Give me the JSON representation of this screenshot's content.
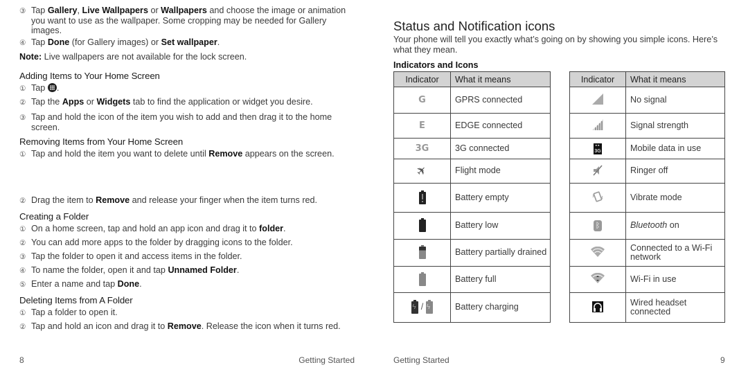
{
  "left_page": {
    "wallpaper_steps": [
      {
        "num": "③",
        "parts": [
          [
            "Tap ",
            false
          ],
          [
            "Gallery",
            true
          ],
          [
            ", ",
            false
          ],
          [
            "Live Wallpapers",
            true
          ],
          [
            " or ",
            false
          ],
          [
            "Wallpapers",
            true
          ],
          [
            " and choose the image or animation you want to use as the wallpaper. Some cropping may be needed for Gallery images.",
            false
          ]
        ]
      },
      {
        "num": "④",
        "parts": [
          [
            "Tap ",
            false
          ],
          [
            "Done",
            true
          ],
          [
            " (for Gallery images) or ",
            false
          ],
          [
            "Set wallpaper",
            true
          ],
          [
            ".",
            false
          ]
        ]
      }
    ],
    "note_label": "Note:",
    "note_text": " Live wallpapers are not available for the lock screen.",
    "adding": {
      "heading": "Adding Items to Your Home Screen",
      "step1_num": "①",
      "step1_text": "Tap ",
      "step1_icon": "apps-launcher-icon",
      "step1_end": ".",
      "steps": [
        {
          "num": "②",
          "parts": [
            [
              "Tap the ",
              false
            ],
            [
              "Apps",
              true
            ],
            [
              " or ",
              false
            ],
            [
              "Widgets",
              true
            ],
            [
              " tab to find the application or widget you desire.",
              false
            ]
          ]
        },
        {
          "num": "③",
          "parts": [
            [
              "Tap and hold the icon of the item you wish to add and then drag it to the home screen.",
              false
            ]
          ]
        }
      ]
    },
    "removing": {
      "heading": "Removing Items from Your Home Screen",
      "steps": [
        {
          "num": "①",
          "parts": [
            [
              "Tap and hold the item you want to delete until ",
              false
            ],
            [
              "Remove",
              true
            ],
            [
              " appears on the screen.",
              false
            ]
          ]
        },
        {
          "num": "②",
          "parts": [
            [
              "Drag the item to ",
              false
            ],
            [
              "Remove",
              true
            ],
            [
              " and release your finger when the item turns red.",
              false
            ]
          ]
        }
      ]
    },
    "creating": {
      "heading": "Creating a Folder",
      "steps": [
        {
          "num": "①",
          "parts": [
            [
              "On a home screen, tap and hold an app icon and drag it to ",
              false
            ],
            [
              "folder",
              true
            ],
            [
              ".",
              false
            ]
          ]
        },
        {
          "num": "②",
          "parts": [
            [
              "You can add more apps to the folder by dragging icons to the folder.",
              false
            ]
          ]
        },
        {
          "num": "③",
          "parts": [
            [
              "Tap the folder to open it and access items in the folder.",
              false
            ]
          ]
        },
        {
          "num": "④",
          "parts": [
            [
              "To name the folder, open it and tap ",
              false
            ],
            [
              "Unnamed Folder",
              true
            ],
            [
              ".",
              false
            ]
          ]
        },
        {
          "num": "⑤",
          "parts": [
            [
              "Enter a name and tap ",
              false
            ],
            [
              "Done",
              true
            ],
            [
              ".",
              false
            ]
          ]
        }
      ]
    },
    "deleting": {
      "heading": "Deleting Items from A Folder",
      "steps": [
        {
          "num": "①",
          "parts": [
            [
              "Tap a folder to open it.",
              false
            ]
          ]
        },
        {
          "num": "②",
          "parts": [
            [
              "Tap and hold an icon and drag it to ",
              false
            ],
            [
              "Remove",
              true
            ],
            [
              ". Release the icon when it turns red.",
              false
            ]
          ]
        }
      ]
    },
    "footer_page": "8",
    "footer_section": "Getting Started"
  },
  "right_page": {
    "title": "Status and Notification icons",
    "intro": "Your phone will tell you exactly what’s going on by showing you simple icons. Here’s what they mean.",
    "subheading": "Indicators and Icons",
    "table_headers": [
      "Indicator",
      "What it means"
    ],
    "table1": [
      {
        "icon": "gprs-icon",
        "glyph": "G",
        "meaning": "GPRS connected"
      },
      {
        "icon": "edge-icon",
        "glyph": "E",
        "meaning": "EDGE connected"
      },
      {
        "icon": "3g-icon",
        "glyph": "3G",
        "meaning": "3G connected"
      },
      {
        "icon": "airplane-icon",
        "glyph": "✈",
        "meaning": "Flight mode"
      },
      {
        "icon": "battery-empty-icon",
        "glyph": "",
        "meaning": "Battery empty"
      },
      {
        "icon": "battery-low-icon",
        "glyph": "",
        "meaning": "Battery low"
      },
      {
        "icon": "battery-partial-icon",
        "glyph": "",
        "meaning": "Battery partially drained"
      },
      {
        "icon": "battery-full-icon",
        "glyph": "",
        "meaning": "Battery full"
      },
      {
        "icon": "battery-charging-icon",
        "glyph": "/",
        "meaning": "Battery charging"
      }
    ],
    "table2": [
      {
        "icon": "no-signal-icon",
        "glyph": "",
        "meaning": "No signal"
      },
      {
        "icon": "signal-strength-icon",
        "glyph": "",
        "meaning": "Signal strength"
      },
      {
        "icon": "mobile-data-icon",
        "glyph": "3G",
        "meaning": "Mobile data in use"
      },
      {
        "icon": "ringer-off-icon",
        "glyph": "🔇",
        "meaning": "Ringer off"
      },
      {
        "icon": "vibrate-icon",
        "glyph": "",
        "meaning": "Vibrate mode"
      },
      {
        "icon": "bluetooth-icon",
        "glyph": "ᛒ",
        "meaning_italic": "Bluetooth",
        "meaning": " on"
      },
      {
        "icon": "wifi-connected-icon",
        "glyph": "",
        "meaning": "Connected to a Wi-Fi network"
      },
      {
        "icon": "wifi-in-use-icon",
        "glyph": "",
        "meaning": "Wi-Fi in use"
      },
      {
        "icon": "headset-icon",
        "glyph": "",
        "meaning": "Wired headset connected"
      }
    ],
    "colors": {
      "header_bg": "#d3d3d3",
      "icon_grey": "#999999",
      "icon_dark": "#333333"
    },
    "footer_section": "Getting Started",
    "footer_page": "9"
  }
}
